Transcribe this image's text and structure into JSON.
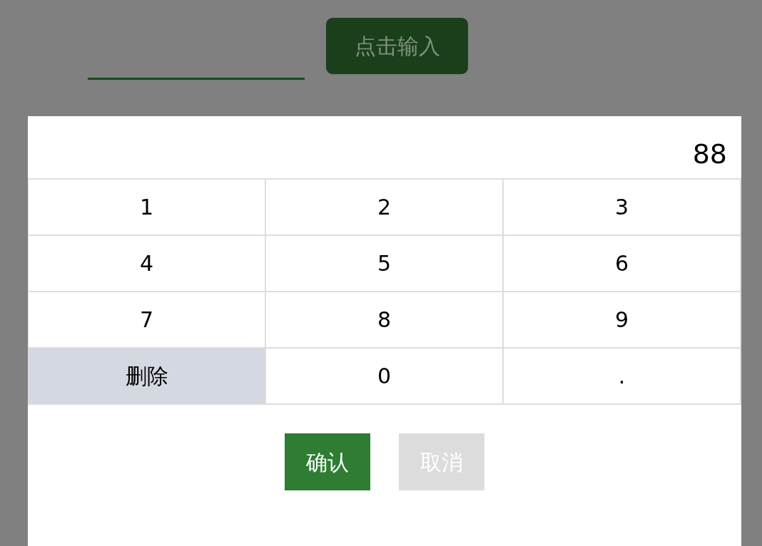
{
  "top_bar": {
    "input_button": "点击输入"
  },
  "display": {
    "value": "88"
  },
  "keys": [
    {
      "label": "1",
      "kind": "digit"
    },
    {
      "label": "2",
      "kind": "digit"
    },
    {
      "label": "3",
      "kind": "digit"
    },
    {
      "label": "4",
      "kind": "digit"
    },
    {
      "label": "5",
      "kind": "digit"
    },
    {
      "label": "6",
      "kind": "digit"
    },
    {
      "label": "7",
      "kind": "digit"
    },
    {
      "label": "8",
      "kind": "digit"
    },
    {
      "label": "9",
      "kind": "digit"
    },
    {
      "label": "删除",
      "kind": "delete"
    },
    {
      "label": "0",
      "kind": "digit"
    },
    {
      "label": ".",
      "kind": "digit"
    }
  ],
  "actions": [
    {
      "label": "确认",
      "kind": "primary"
    },
    {
      "label": "取消",
      "kind": "secondary"
    }
  ]
}
